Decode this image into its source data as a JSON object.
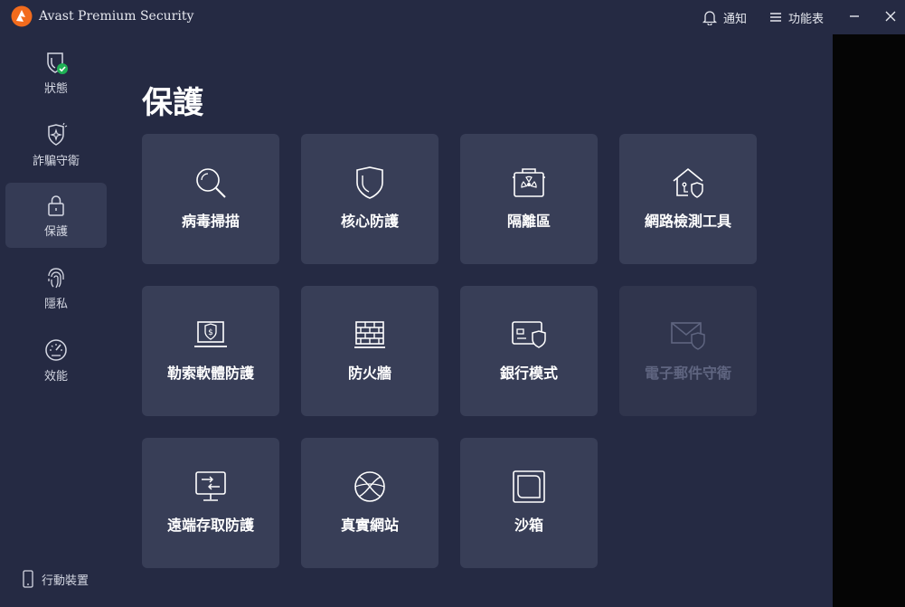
{
  "app": {
    "title": "Avast Premium Security"
  },
  "titlebar": {
    "notify_label": "通知",
    "menu_label": "功能表"
  },
  "sidebar": {
    "items": [
      {
        "label": "狀態",
        "icon": "shield-check-icon",
        "active": false
      },
      {
        "label": "詐騙守衛",
        "icon": "scam-shield-icon",
        "active": false
      },
      {
        "label": "保護",
        "icon": "lock-icon",
        "active": true
      },
      {
        "label": "隱私",
        "icon": "fingerprint-icon",
        "active": false
      },
      {
        "label": "效能",
        "icon": "speedometer-icon",
        "active": false
      }
    ],
    "mobile_label": "行動裝置"
  },
  "main": {
    "title": "保護",
    "cards": [
      {
        "label": "病毒掃描",
        "icon": "magnifier-icon",
        "enabled": true
      },
      {
        "label": "核心防護",
        "icon": "shield-icon",
        "enabled": true
      },
      {
        "label": "隔離區",
        "icon": "quarantine-box-icon",
        "enabled": true
      },
      {
        "label": "網路檢測工具",
        "icon": "home-network-shield-icon",
        "enabled": true
      },
      {
        "label": "勒索軟體防護",
        "icon": "laptop-dollar-shield-icon",
        "enabled": true
      },
      {
        "label": "防火牆",
        "icon": "brick-wall-icon",
        "enabled": true
      },
      {
        "label": "銀行模式",
        "icon": "card-shield-icon",
        "enabled": true
      },
      {
        "label": "電子郵件守衛",
        "icon": "envelope-shield-icon",
        "enabled": false
      },
      {
        "label": "遠端存取防護",
        "icon": "remote-monitor-arrows-icon",
        "enabled": true
      },
      {
        "label": "真實網站",
        "icon": "globe-icon",
        "enabled": true
      },
      {
        "label": "沙箱",
        "icon": "sandbox-square-icon",
        "enabled": true
      }
    ]
  },
  "colors": {
    "background": "#252a43",
    "card": "#383e57",
    "accent": "#f26b1d",
    "success": "#1fb155"
  }
}
